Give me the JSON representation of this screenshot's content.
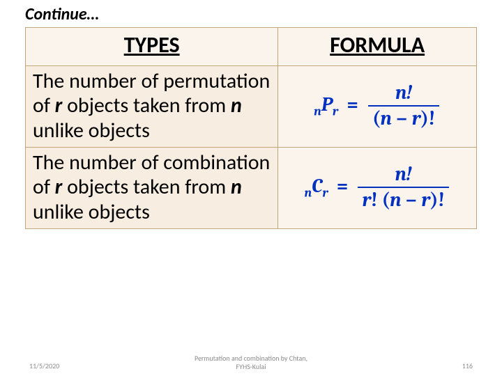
{
  "title": "Continue…",
  "headers": {
    "types": "TYPES",
    "formula": "FORMULA"
  },
  "rows": [
    {
      "type_pre": "The number of permutation of ",
      "type_var1": "r",
      "type_mid": " objects taken from ",
      "type_var2": "n",
      "type_post": " unlike objects",
      "formula": {
        "lhs_pre": "n",
        "lhs_op": "P",
        "lhs_sub": "r",
        "num": "n!",
        "den_pre": "(",
        "den_a": "n",
        "den_minus": " − ",
        "den_b": "r",
        "den_post": ")!"
      }
    },
    {
      "type_pre": "The number of combination of ",
      "type_var1": "r",
      "type_mid": " objects taken from ",
      "type_var2": "n",
      "type_post": " unlike objects",
      "formula": {
        "lhs_pre": "n",
        "lhs_op": "C",
        "lhs_sub": "r",
        "num": "n!",
        "den_a": "r",
        "den_excl1": "! ",
        "den_pre": "(",
        "den_b": "n",
        "den_minus": " − ",
        "den_c": "r",
        "den_post": ")!"
      }
    }
  ],
  "footer": {
    "date": "11/5/2020",
    "center_line1": "Permutation and combination by Chtan,",
    "center_line2": "FYHS-Kulai",
    "page": "116"
  }
}
